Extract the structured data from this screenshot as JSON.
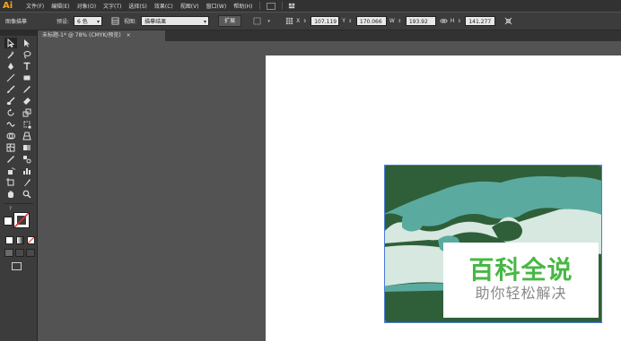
{
  "app": {
    "logo": "Ai"
  },
  "menu": {
    "items": [
      "文件(F)",
      "编辑(E)",
      "对象(O)",
      "文字(T)",
      "选择(S)",
      "效果(C)",
      "视图(V)",
      "窗口(W)",
      "帮助(H)"
    ]
  },
  "control": {
    "object_type": "图像描摹",
    "preset_label": "预设:",
    "preset_value": "6 色",
    "view_label": "视图:",
    "view_value": "描摹结果",
    "expand_label": "扩展",
    "x_value": "107.119",
    "y_value": "170.066",
    "w_value": "193.92",
    "h_value": "141.277"
  },
  "document": {
    "tab_title": "未标题-1* @ 78% (CMYK/预览)",
    "tab_close": "×"
  },
  "watermark": {
    "title": "百科全说",
    "subtitle": "助你轻松解决"
  },
  "colors": {
    "artwork_dark_green": "#2f5f38",
    "artwork_teal": "#5aaaa0",
    "artwork_pale": "#d6e8e0",
    "watermark_green": "#47b843"
  }
}
